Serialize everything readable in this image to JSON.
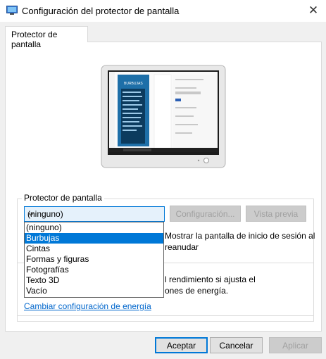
{
  "window": {
    "title": "Configuración del protector de pantalla",
    "close_glyph": "✕"
  },
  "tabs": [
    {
      "label": "Protector de pantalla"
    }
  ],
  "preview": {
    "mini_title": "BURBUJAS"
  },
  "screensaver": {
    "group_label": "Protector de pantalla",
    "selected": "(ninguno)",
    "options": [
      "(ninguno)",
      "Burbujas",
      "Cintas",
      "Formas y figuras",
      "Fotografías",
      "Texto 3D",
      "Vacío"
    ],
    "highlighted_option": "Burbujas",
    "settings_label": "Configuración...",
    "preview_label": "Vista previa",
    "logon_line1": "Mostrar la pantalla de inicio de sesión al",
    "logon_line2": "reanudar"
  },
  "power": {
    "line1": "l rendimiento si ajusta el",
    "line2": "ones de energía.",
    "link": "Cambiar configuración de energía"
  },
  "footer": {
    "accept_label": "Aceptar",
    "cancel_label": "Cancelar",
    "apply_label": "Aplicar"
  },
  "colors": {
    "accent": "#0078d7",
    "link": "#0066cc"
  }
}
